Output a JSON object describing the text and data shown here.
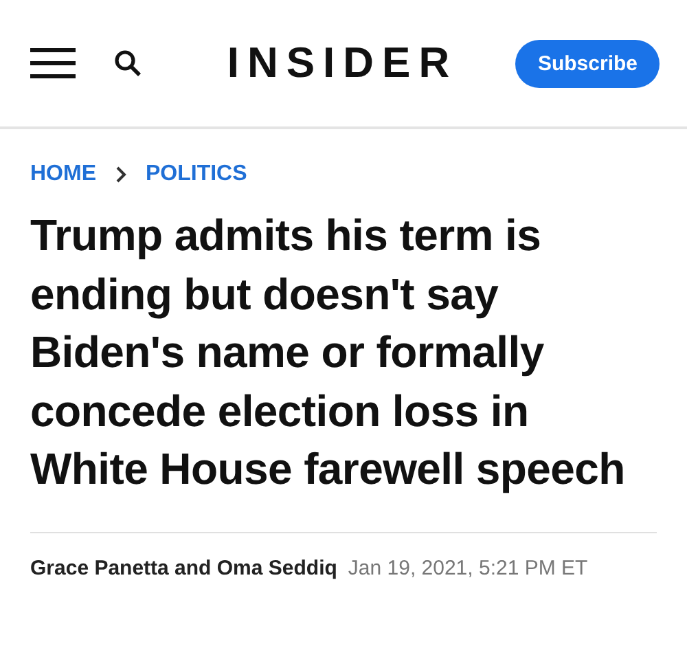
{
  "header": {
    "logo": "INSIDER",
    "subscribe": "Subscribe"
  },
  "breadcrumb": [
    "HOME",
    "POLITICS"
  ],
  "headline": "Trump admits his term is ending but doesn't say Biden's name or formally concede election loss in White House farewell speech",
  "byline": {
    "authors": "Grace Panetta and Oma Seddiq",
    "date": "Jan 19, 2021, 5:21 PM ET"
  }
}
